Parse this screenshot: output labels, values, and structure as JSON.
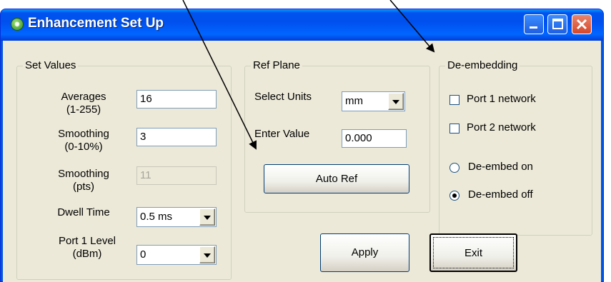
{
  "window": {
    "title": "Enhancement Set Up"
  },
  "set_values": {
    "legend": "Set Values",
    "averages_label_1": "Averages",
    "averages_label_2": "(1-255)",
    "averages_value": "16",
    "smoothing_pct_label_1": "Smoothing",
    "smoothing_pct_label_2": "(0-10%)",
    "smoothing_pct_value": "3",
    "smoothing_pts_label_1": "Smoothing",
    "smoothing_pts_label_2": "(pts)",
    "smoothing_pts_value": "11",
    "dwell_label": "Dwell Time",
    "dwell_value": "0.5 ms",
    "port_level_label_1": "Port 1 Level",
    "port_level_label_2": "(dBm)",
    "port_level_value": "0"
  },
  "ref_plane": {
    "legend": "Ref Plane",
    "units_label": "Select Units",
    "units_value": "mm",
    "enter_label": "Enter Value",
    "enter_value": "0.000",
    "auto_ref_label": "Auto Ref"
  },
  "deembedding": {
    "legend": "De-embedding",
    "port1_label": "Port 1 network",
    "port1_checked": false,
    "port2_label": "Port 2 network",
    "port2_checked": false,
    "on_label": "De-embed on",
    "off_label": "De-embed off",
    "selected": "off"
  },
  "buttons": {
    "apply": "Apply",
    "exit": "Exit"
  },
  "colors": {
    "titlebar": "#0054e3",
    "client": "#ece9d8",
    "close_button": "#d4472a"
  }
}
